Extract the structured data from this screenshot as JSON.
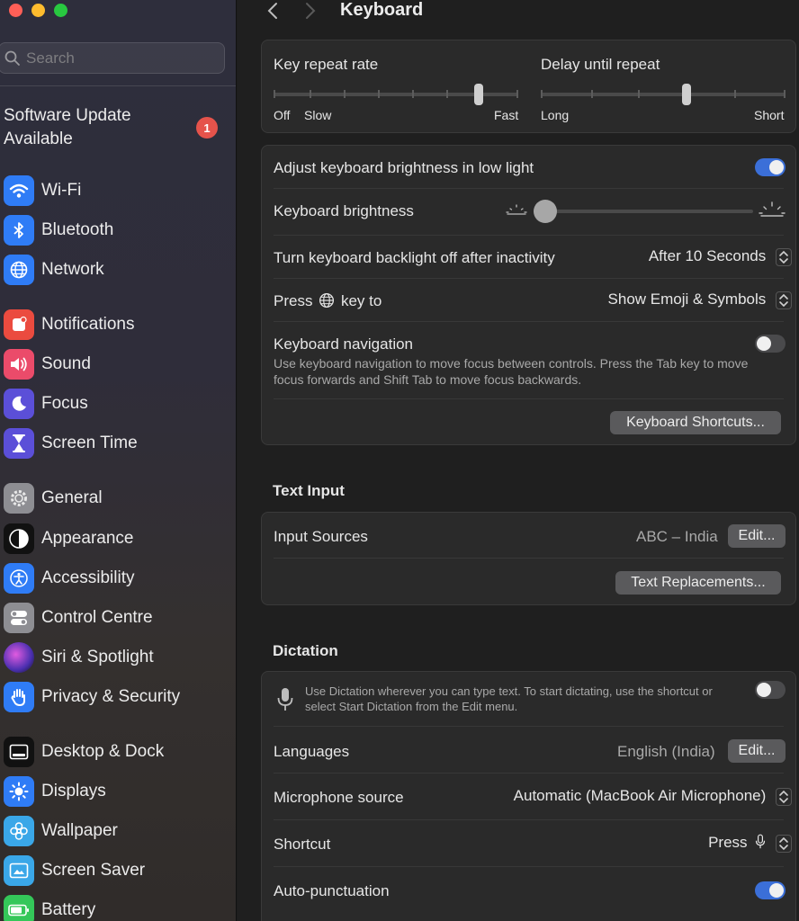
{
  "sidebar": {
    "search_placeholder": "Search",
    "update": {
      "label": "Software Update Available",
      "badge": "1"
    },
    "items": [
      {
        "label": "Wi-Fi",
        "icon": "wifi-icon",
        "color": "#2f7cf6"
      },
      {
        "label": "Bluetooth",
        "icon": "bluetooth-icon",
        "color": "#2f7cf6"
      },
      {
        "label": "Network",
        "icon": "globe-icon",
        "color": "#2f7cf6"
      },
      {
        "label": "Notifications",
        "icon": "bell-icon",
        "color": "#eb4b3f"
      },
      {
        "label": "Sound",
        "icon": "speaker-icon",
        "color": "#eb4b6a"
      },
      {
        "label": "Focus",
        "icon": "moon-icon",
        "color": "#5b4fd8"
      },
      {
        "label": "Screen Time",
        "icon": "hourglass-icon",
        "color": "#5b4fd8"
      },
      {
        "label": "General",
        "icon": "gear-icon",
        "color": "#8e8e93"
      },
      {
        "label": "Appearance",
        "icon": "appearance-icon",
        "color": "#111111"
      },
      {
        "label": "Accessibility",
        "icon": "accessibility-icon",
        "color": "#2f7cf6"
      },
      {
        "label": "Control Centre",
        "icon": "control-centre-icon",
        "color": "#8e8e93"
      },
      {
        "label": "Siri & Spotlight",
        "icon": "siri-icon",
        "color": "#7a3ee0"
      },
      {
        "label": "Privacy & Security",
        "icon": "hand-icon",
        "color": "#2f7cf6"
      },
      {
        "label": "Desktop & Dock",
        "icon": "dock-icon",
        "color": "#111111"
      },
      {
        "label": "Displays",
        "icon": "sun-icon",
        "color": "#2f7cf6"
      },
      {
        "label": "Wallpaper",
        "icon": "flower-icon",
        "color": "#3aa7e8"
      },
      {
        "label": "Screen Saver",
        "icon": "screen-saver-icon",
        "color": "#3aa7e8"
      },
      {
        "label": "Battery",
        "icon": "battery-icon",
        "color": "#34c759"
      }
    ]
  },
  "header": {
    "title": "Keyboard"
  },
  "repeat": {
    "key_repeat_label": "Key repeat rate",
    "key_repeat_off": "Off",
    "key_repeat_slow": "Slow",
    "key_repeat_fast": "Fast",
    "delay_label": "Delay until repeat",
    "delay_long": "Long",
    "delay_short": "Short"
  },
  "keyboard": {
    "adjust_brightness_label": "Adjust keyboard brightness in low light",
    "brightness_label": "Keyboard brightness",
    "backlight_label": "Turn keyboard backlight off after inactivity",
    "backlight_value": "After 10 Seconds",
    "press_key_prefix": "Press",
    "press_key_suffix": "key to",
    "press_key_value": "Show Emoji & Symbols",
    "navigation_label": "Keyboard navigation",
    "navigation_desc": "Use keyboard navigation to move focus between controls. Press the Tab key to move focus forwards and Shift Tab to move focus backwards.",
    "shortcuts_button": "Keyboard Shortcuts..."
  },
  "text_input": {
    "section_title": "Text Input",
    "input_sources_label": "Input Sources",
    "input_sources_value": "ABC – India",
    "edit_button": "Edit...",
    "replacements_button": "Text Replacements..."
  },
  "dictation": {
    "section_title": "Dictation",
    "desc": "Use Dictation wherever you can type text. To start dictating, use the shortcut or select Start Dictation from the Edit menu.",
    "languages_label": "Languages",
    "languages_value": "English (India)",
    "edit_button": "Edit...",
    "mic_label": "Microphone source",
    "mic_value": "Automatic (MacBook Air Microphone)",
    "shortcut_label": "Shortcut",
    "shortcut_value": "Press",
    "autopunct_label": "Auto-punctuation"
  },
  "colors": {
    "accent": "#3b6fd8",
    "badge": "#e5534b"
  }
}
